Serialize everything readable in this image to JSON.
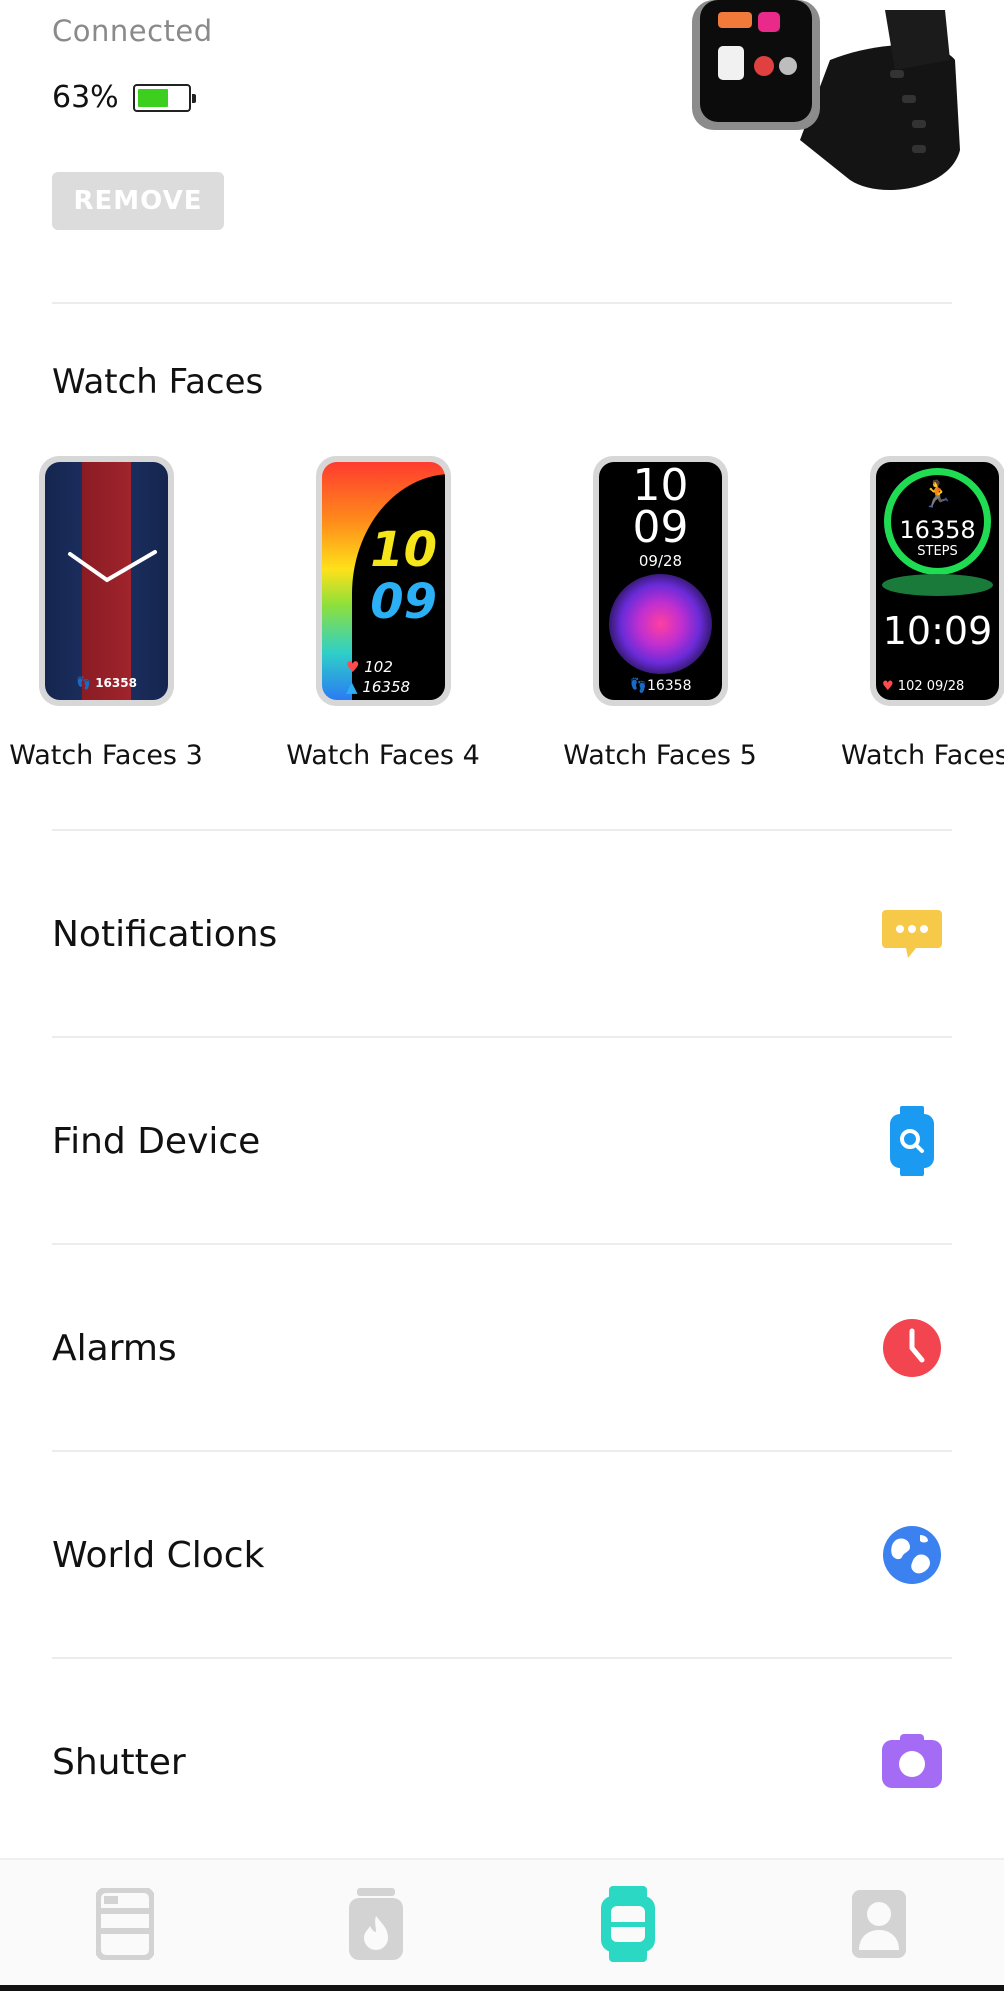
{
  "device": {
    "status": "Connected",
    "battery_percent": "63%",
    "battery_level": 0.63,
    "remove_label": "REMOVE"
  },
  "watch_faces": {
    "title": "Watch Faces",
    "items": [
      {
        "label": "Watch Faces 3",
        "steps": "16358"
      },
      {
        "label": "Watch Faces 4",
        "hour": "10",
        "minute": "09",
        "heart": "102",
        "steps": "16358"
      },
      {
        "label": "Watch Faces 5",
        "hour": "10",
        "minute": "09",
        "date": "09/28",
        "steps": "16358"
      },
      {
        "label": "Watch Faces",
        "steps": "16358",
        "steps_label": "STEPS",
        "time": "10:09",
        "heart": "102",
        "date": "09/28"
      }
    ]
  },
  "menu": {
    "items": [
      {
        "label": "Notifications",
        "icon": "chat-bubble-icon",
        "color": "#f7c948"
      },
      {
        "label": "Find Device",
        "icon": "find-watch-icon",
        "color": "#1a9af0"
      },
      {
        "label": "Alarms",
        "icon": "alarm-clock-icon",
        "color": "#f2454f"
      },
      {
        "label": "World Clock",
        "icon": "globe-icon",
        "color": "#3b82f0"
      },
      {
        "label": "Shutter",
        "icon": "camera-icon",
        "color": "#a46cf5"
      }
    ]
  },
  "bottom_nav": {
    "items": [
      {
        "name": "dashboard",
        "icon": "dashboard-icon",
        "active": false
      },
      {
        "name": "workout",
        "icon": "flame-icon",
        "active": false
      },
      {
        "name": "device",
        "icon": "watch-icon",
        "active": true
      },
      {
        "name": "profile",
        "icon": "person-icon",
        "active": false
      }
    ],
    "active_color": "#2bd8c4",
    "inactive_color": "#d3d3d3"
  }
}
